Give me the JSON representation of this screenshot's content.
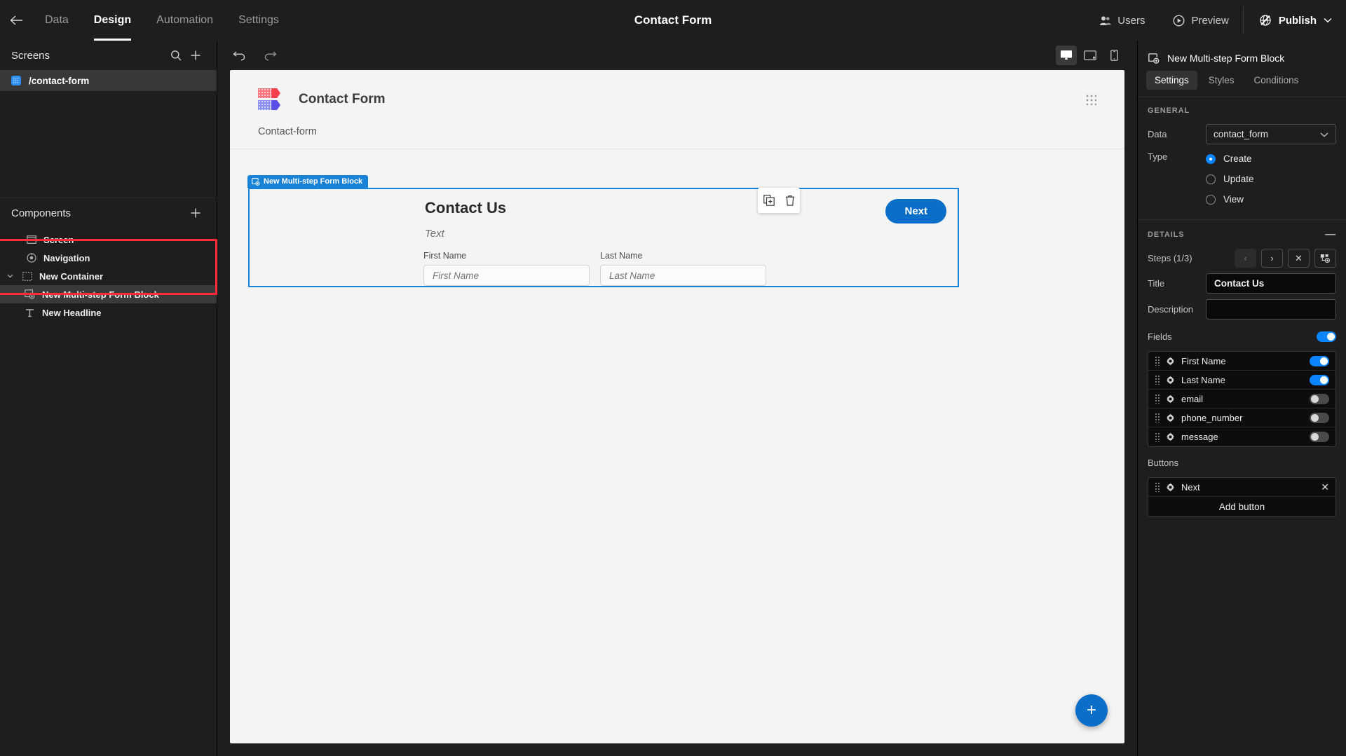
{
  "topbar": {
    "back_icon": "arrow-left-icon",
    "nav": [
      {
        "label": "Data",
        "active": false
      },
      {
        "label": "Design",
        "active": true
      },
      {
        "label": "Automation",
        "active": false
      },
      {
        "label": "Settings",
        "active": false
      }
    ],
    "title": "Contact Form",
    "users_label": "Users",
    "preview_label": "Preview",
    "publish_label": "Publish"
  },
  "left": {
    "screens_title": "Screens",
    "screens": [
      {
        "label": "/contact-form",
        "selected": true
      }
    ],
    "components_title": "Components",
    "tree": [
      {
        "label": "Screen",
        "icon": "screen-icon",
        "depth": 0,
        "selected": false,
        "caret": false
      },
      {
        "label": "Navigation",
        "icon": "navigation-icon",
        "depth": 0,
        "selected": false,
        "caret": false
      },
      {
        "label": "New Container",
        "icon": "container-icon",
        "depth": 0,
        "selected": false,
        "caret": true
      },
      {
        "label": "New Multi-step Form Block",
        "icon": "form-block-icon",
        "depth": 1,
        "selected": true,
        "caret": false
      },
      {
        "label": "New Headline",
        "icon": "text-icon",
        "depth": 1,
        "selected": false,
        "caret": false
      }
    ],
    "highlight_color": "#ff2b3c"
  },
  "canvas": {
    "undo_icon": "undo-icon",
    "redo_icon": "redo-icon",
    "devices": [
      {
        "name": "desktop-icon",
        "active": true
      },
      {
        "name": "tablet-icon",
        "active": false
      },
      {
        "name": "mobile-icon",
        "active": false
      }
    ],
    "site_title": "Contact Form",
    "breadcrumb": "Contact-form",
    "float_tools": [
      {
        "name": "duplicate-icon"
      },
      {
        "name": "trash-icon"
      }
    ],
    "block_tag": "New Multi-step Form Block",
    "form": {
      "title": "Contact Us",
      "subtitle": "Text",
      "next_label": "Next",
      "fields": [
        {
          "label": "First Name",
          "placeholder": "First Name",
          "value": ""
        },
        {
          "label": "Last Name",
          "placeholder": "Last Name",
          "value": ""
        }
      ]
    },
    "fab_label": "+",
    "accent": "#0b6fc9"
  },
  "right": {
    "block_name": "New Multi-step Form Block",
    "tabs": [
      {
        "label": "Settings",
        "active": true
      },
      {
        "label": "Styles",
        "active": false
      },
      {
        "label": "Conditions",
        "active": false
      }
    ],
    "general_title": "GENERAL",
    "data_label": "Data",
    "data_value": "contact_form",
    "type_label": "Type",
    "type_options": [
      {
        "label": "Create",
        "selected": true
      },
      {
        "label": "Update",
        "selected": false
      },
      {
        "label": "View",
        "selected": false
      }
    ],
    "details_title": "DETAILS",
    "steps_label": "Steps (1/3)",
    "steps_buttons": [
      {
        "name": "prev-step-button",
        "glyph": "‹",
        "disabled": true
      },
      {
        "name": "next-step-button",
        "glyph": "›",
        "disabled": false
      },
      {
        "name": "delete-step-button",
        "glyph": "✕",
        "disabled": false
      },
      {
        "name": "add-step-button",
        "glyph": "",
        "disabled": false
      }
    ],
    "title_label": "Title",
    "title_value": "Contact Us",
    "description_label": "Description",
    "description_value": "",
    "fields_label": "Fields",
    "fields_master_on": true,
    "fields": [
      {
        "label": "First Name",
        "on": true
      },
      {
        "label": "Last Name",
        "on": true
      },
      {
        "label": "email",
        "on": false
      },
      {
        "label": "phone_number",
        "on": false
      },
      {
        "label": "message",
        "on": false
      }
    ],
    "buttons_label": "Buttons",
    "buttons": [
      {
        "label": "Next"
      }
    ],
    "add_button_label": "Add button",
    "accent": "#0a84ff"
  }
}
